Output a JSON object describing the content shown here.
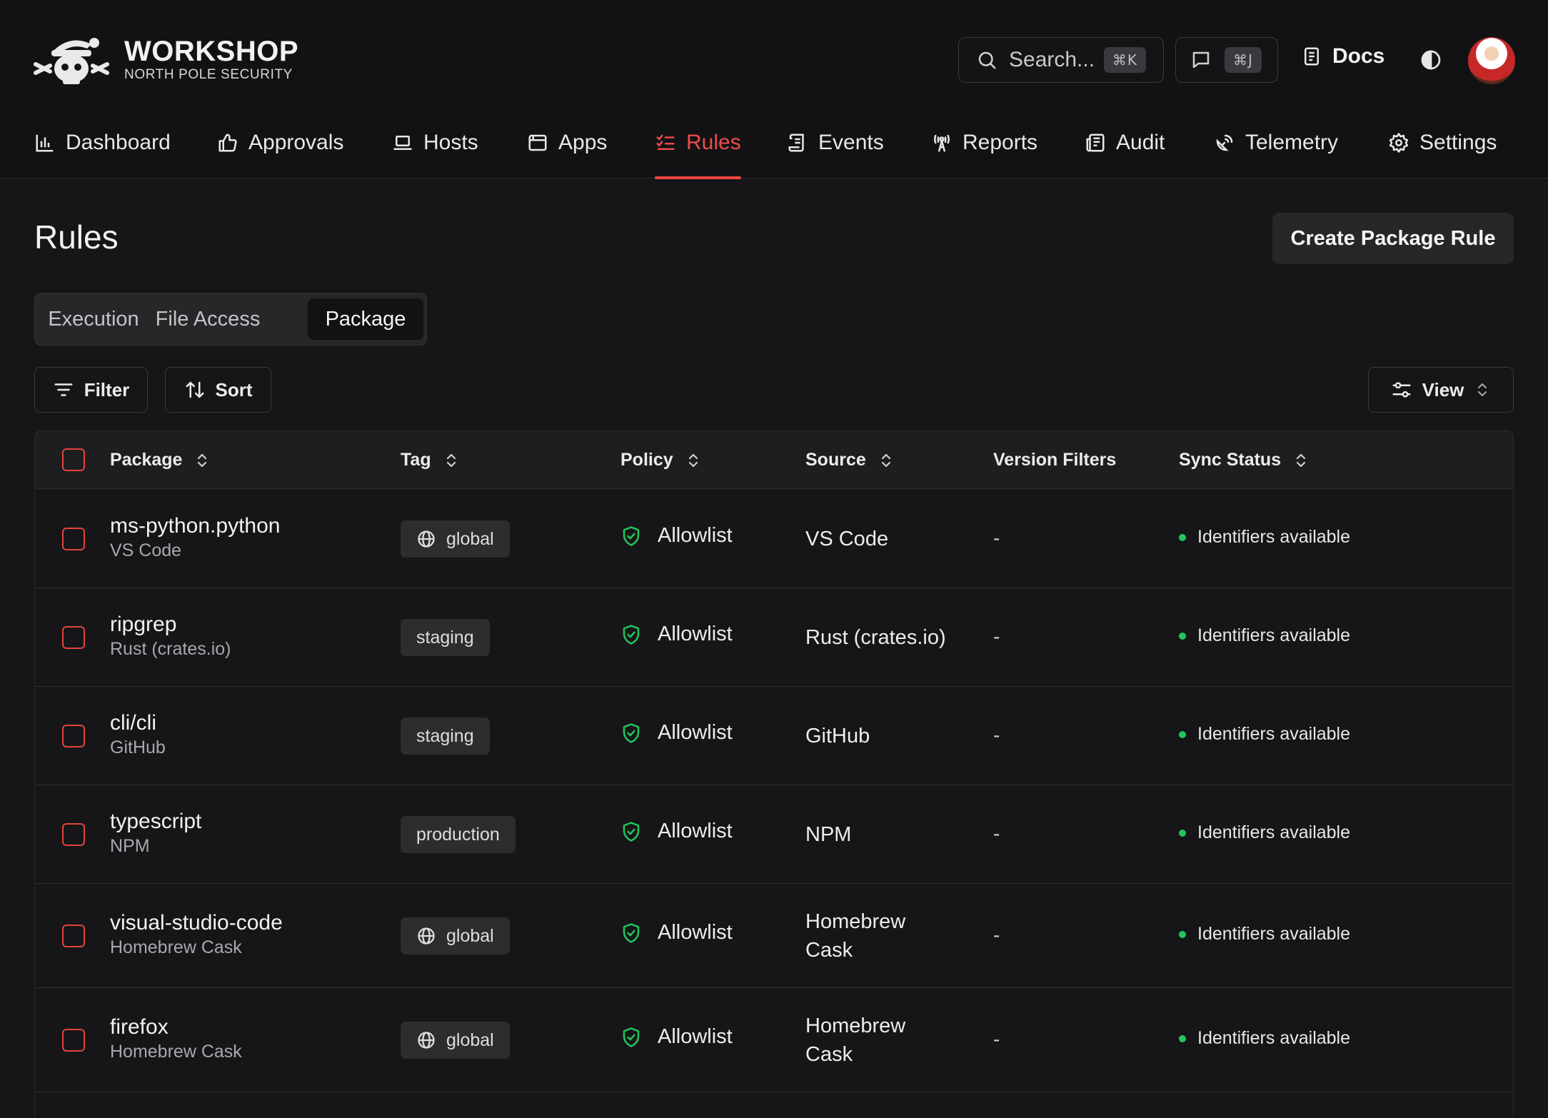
{
  "brand": {
    "title": "WORKSHOP",
    "subtitle": "NORTH POLE SECURITY",
    "logo_icon": "santa-hat-skull-icon"
  },
  "header": {
    "search_placeholder": "Search...",
    "search_shortcut": "⌘K",
    "chat_shortcut": "⌘J",
    "docs_label": "Docs"
  },
  "nav": [
    {
      "label": "Dashboard",
      "icon": "bar-chart-icon"
    },
    {
      "label": "Approvals",
      "icon": "thumbs-up-icon"
    },
    {
      "label": "Hosts",
      "icon": "laptop-icon"
    },
    {
      "label": "Apps",
      "icon": "app-window-icon"
    },
    {
      "label": "Rules",
      "icon": "list-checks-icon",
      "active": true
    },
    {
      "label": "Events",
      "icon": "scroll-icon"
    },
    {
      "label": "Reports",
      "icon": "radio-tower-icon"
    },
    {
      "label": "Audit",
      "icon": "newspaper-icon"
    },
    {
      "label": "Telemetry",
      "icon": "satellite-dish-icon"
    },
    {
      "label": "Settings",
      "icon": "gear-icon"
    }
  ],
  "page": {
    "title": "Rules",
    "create_button": "Create Package Rule"
  },
  "tabs": [
    {
      "label": "Execution"
    },
    {
      "label": "File Access"
    },
    {
      "label": "Package",
      "active": true
    }
  ],
  "toolbar": {
    "filter_label": "Filter",
    "sort_label": "Sort",
    "view_label": "View"
  },
  "table": {
    "columns": [
      "Package",
      "Tag",
      "Policy",
      "Source",
      "Version Filters",
      "Sync Status"
    ],
    "rows": [
      {
        "name": "ms-python.python",
        "sub": "VS Code",
        "tag": "global",
        "tag_icon": true,
        "policy": "Allowlist",
        "source": "VS Code",
        "version_filters": "-",
        "sync": "Identifiers available"
      },
      {
        "name": "ripgrep",
        "sub": "Rust (crates.io)",
        "tag": "staging",
        "tag_icon": false,
        "policy": "Allowlist",
        "source": "Rust (crates.io)",
        "version_filters": "-",
        "sync": "Identifiers available"
      },
      {
        "name": "cli/cli",
        "sub": "GitHub",
        "tag": "staging",
        "tag_icon": false,
        "policy": "Allowlist",
        "source": "GitHub",
        "version_filters": "-",
        "sync": "Identifiers available"
      },
      {
        "name": "typescript",
        "sub": "NPM",
        "tag": "production",
        "tag_icon": false,
        "policy": "Allowlist",
        "source": "NPM",
        "version_filters": "-",
        "sync": "Identifiers available"
      },
      {
        "name": "visual-studio-code",
        "sub": "Homebrew Cask",
        "tag": "global",
        "tag_icon": true,
        "policy": "Allowlist",
        "source": "Homebrew Cask",
        "version_filters": "-",
        "sync": "Identifiers available"
      },
      {
        "name": "firefox",
        "sub": "Homebrew Cask",
        "tag": "global",
        "tag_icon": true,
        "policy": "Allowlist",
        "source": "Homebrew Cask",
        "version_filters": "-",
        "sync": "Identifiers available"
      }
    ]
  },
  "colors": {
    "accent": "#ef4444",
    "allow": "#22c55e",
    "background": "#161618"
  }
}
